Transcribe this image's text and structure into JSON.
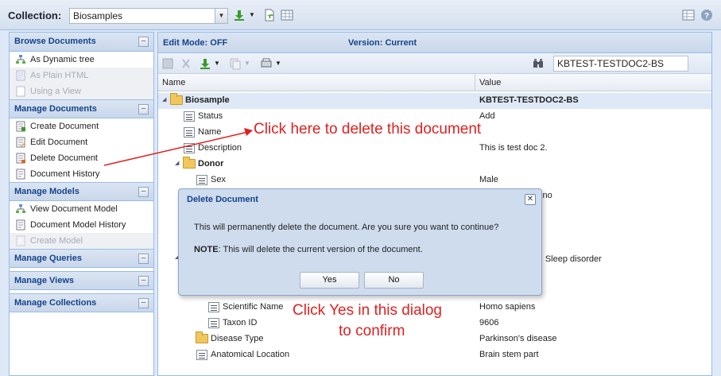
{
  "topbar": {
    "collection_label": "Collection:",
    "collection_value": "Biosamples"
  },
  "sidebar": {
    "sections": [
      {
        "title": "Browse Documents",
        "items": [
          {
            "label": "As Dynamic tree",
            "icon": "tree-icon",
            "disabled": false
          },
          {
            "label": "As Plain HTML",
            "icon": "html-icon",
            "disabled": true
          },
          {
            "label": "Using a View",
            "icon": "view-icon",
            "disabled": true
          }
        ]
      },
      {
        "title": "Manage Documents",
        "items": [
          {
            "label": "Create Document",
            "icon": "create-doc-icon",
            "disabled": false
          },
          {
            "label": "Edit Document",
            "icon": "edit-doc-icon",
            "disabled": false
          },
          {
            "label": "Delete Document",
            "icon": "delete-doc-icon",
            "disabled": false
          },
          {
            "label": "Document History",
            "icon": "history-icon",
            "disabled": false
          }
        ]
      },
      {
        "title": "Manage Models",
        "items": [
          {
            "label": "View Document Model",
            "icon": "tree-icon",
            "disabled": false
          },
          {
            "label": "Document Model History",
            "icon": "history-icon",
            "disabled": false
          },
          {
            "label": "Create Model",
            "icon": "create-model-icon",
            "disabled": true
          }
        ]
      },
      {
        "title": "Manage Queries",
        "items": []
      },
      {
        "title": "Manage Views",
        "items": []
      },
      {
        "title": "Manage Collections",
        "items": []
      }
    ]
  },
  "main": {
    "edit_mode": "Edit Mode: OFF",
    "version": "Version: Current",
    "search_value": "KBTEST-TESTDOC2-BS",
    "columns": [
      "Name",
      "Value"
    ],
    "rows": [
      {
        "name": "Biosample",
        "value": "KBTEST-TESTDOC2-BS"
      },
      {
        "name": "Status",
        "value": "Add"
      },
      {
        "name": "Name",
        "value": ""
      },
      {
        "name": "Description",
        "value": "This is test doc 2."
      },
      {
        "name": "Donor",
        "value": ""
      },
      {
        "name": "Sex",
        "value": "Male"
      },
      {
        "name": "",
        "value": "tino"
      },
      {
        "name": "",
        "value": "ase, Sleep disorder"
      },
      {
        "name": "Scientific Name",
        "value": "Homo sapiens"
      },
      {
        "name": "Taxon ID",
        "value": "9606"
      },
      {
        "name": "Disease Type",
        "value": "Parkinson's disease"
      },
      {
        "name": "Anatomical Location",
        "value": "Brain stem part"
      }
    ]
  },
  "dialog": {
    "title": "Delete Document",
    "message": "This will permanently delete the document. Are you sure you want to continue?",
    "note_label": "NOTE",
    "note_text": ": This will delete the current version of the document.",
    "yes_label": "Yes",
    "no_label": "No"
  },
  "annotations": {
    "click_here": "Click here to delete this document",
    "click_yes_line1": "Click Yes in this dialog",
    "click_yes_line2": "to confirm",
    "color": "#e02020"
  }
}
